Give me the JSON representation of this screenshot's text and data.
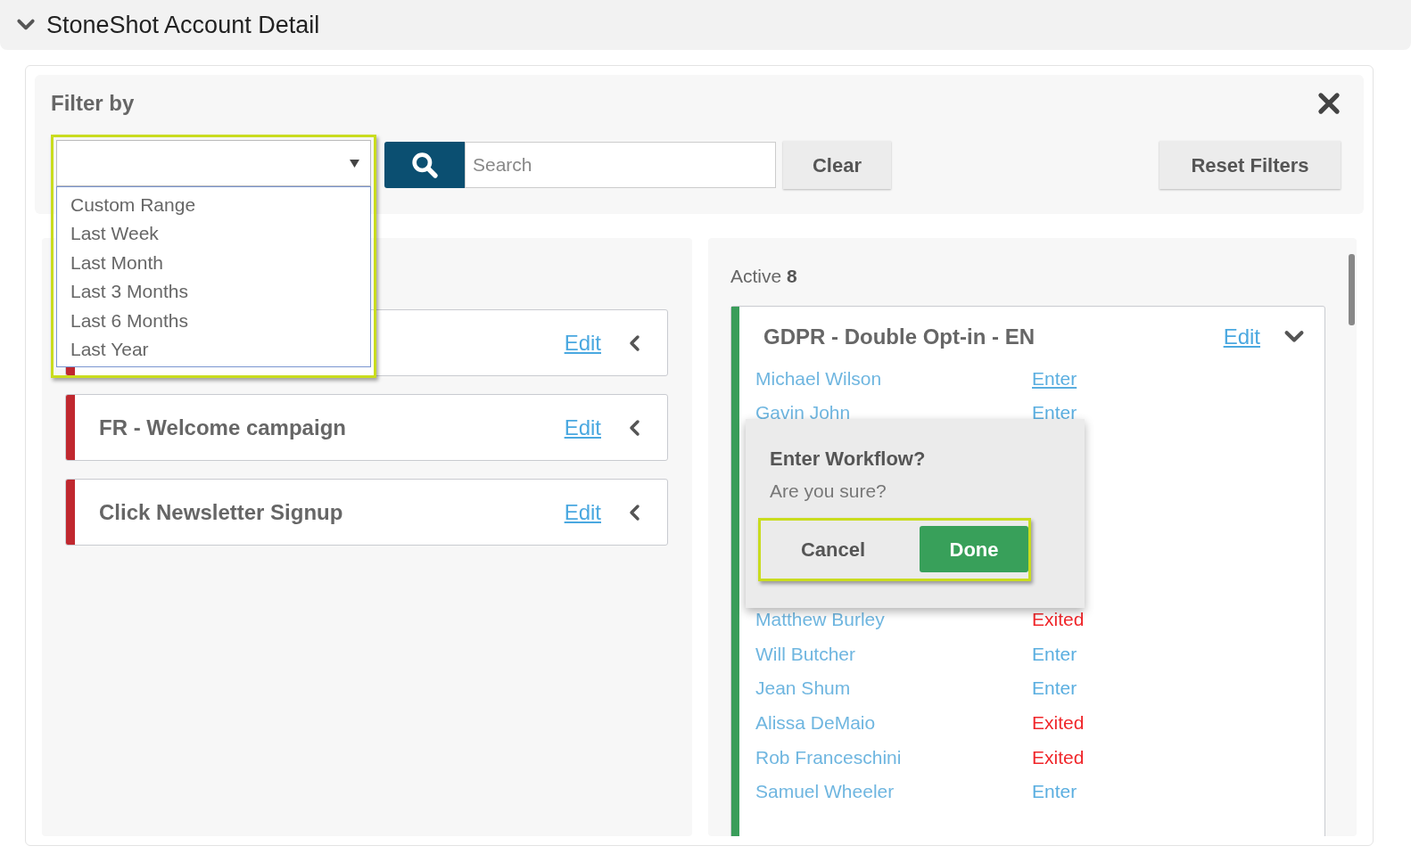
{
  "section": {
    "title": "StoneShot Account Detail",
    "expanded": true
  },
  "filter": {
    "label": "Filter by",
    "search_placeholder": "Search",
    "clear": "Clear",
    "reset": "Reset Filters",
    "dropdown": {
      "open": true,
      "options": [
        {
          "label": "Custom Range",
          "selected": false
        },
        {
          "label": "Last Week",
          "selected": false
        },
        {
          "label": "Last Month",
          "selected": false
        },
        {
          "label": "Last 3 Months",
          "selected": false
        },
        {
          "label": "Last 6 Months",
          "selected": false
        },
        {
          "label": "Last Year",
          "selected": false
        }
      ]
    }
  },
  "inactive_campaigns": [
    {
      "edit": "Edit",
      "color": "#c0282f"
    },
    {
      "title": "FR - Welcome campaign",
      "edit": "Edit",
      "color": "#c0282f"
    },
    {
      "title": "Click Newsletter Signup",
      "edit": "Edit",
      "color": "#c0282f"
    }
  ],
  "active": {
    "label": "Active",
    "count": "8",
    "campaign": {
      "title": "GDPR - Double Opt-in - EN",
      "edit": "Edit",
      "color": "#3a9d5a",
      "expanded": true,
      "contacts": [
        {
          "name": "Michael Wilson",
          "status": "Enter",
          "kind": "enter",
          "underlined": true
        },
        {
          "name": "Gavin John",
          "status": "Enter",
          "kind": "enter",
          "underlined": false
        },
        {
          "name": "Matthew Burley",
          "status": "Exited",
          "kind": "exited",
          "underlined": false
        },
        {
          "name": "Will Butcher",
          "status": "Enter",
          "kind": "enter",
          "underlined": false
        },
        {
          "name": "Jean Shum",
          "status": "Enter",
          "kind": "enter",
          "underlined": false
        },
        {
          "name": "Alissa DeMaio",
          "status": "Exited",
          "kind": "exited",
          "underlined": false
        },
        {
          "name": "Rob Franceschini",
          "status": "Exited",
          "kind": "exited",
          "underlined": false
        },
        {
          "name": "Samuel Wheeler",
          "status": "Enter",
          "kind": "enter",
          "underlined": false
        }
      ]
    }
  },
  "confirm": {
    "title": "Enter Workflow?",
    "message": "Are you sure?",
    "cancel": "Cancel",
    "done": "Done"
  }
}
